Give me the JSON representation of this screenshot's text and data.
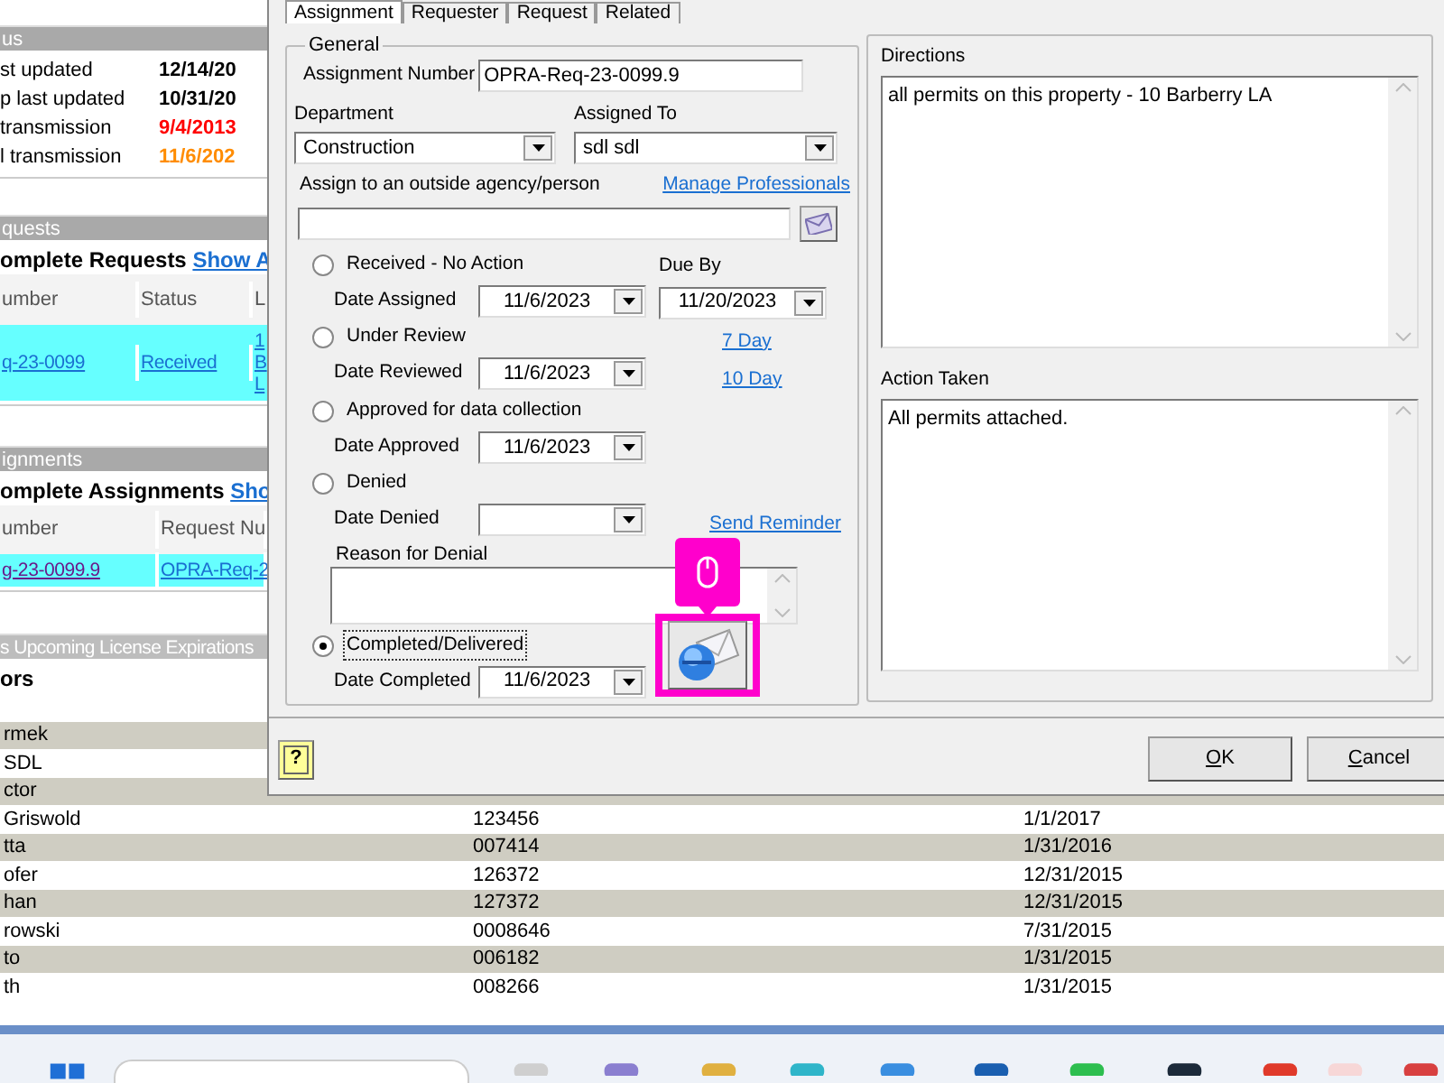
{
  "background_page": {
    "status_section": {
      "title": "us",
      "rows": [
        {
          "label": "st updated",
          "value": "12/14/20",
          "color": "#000000"
        },
        {
          "label": "p last updated",
          "value": "10/31/20",
          "color": "#000000"
        },
        {
          "label": "transmission",
          "value": "9/4/2013",
          "color": "#ff0000"
        },
        {
          "label": "l transmission",
          "value": "11/6/202",
          "color": "#ff8c00"
        }
      ]
    },
    "requests_section": {
      "title": "quests",
      "heading": "omplete Requests",
      "link": "Show A",
      "columns": [
        "umber",
        "Status",
        "L"
      ],
      "rows": [
        {
          "cells": [
            "q-23-0099",
            "Received"
          ],
          "location_lines": [
            "1",
            "B",
            "L"
          ]
        }
      ]
    },
    "assignments_section": {
      "title": "ignments",
      "heading": "omplete Assignments",
      "link": "Sho",
      "columns": [
        "umber",
        "Request Nu"
      ],
      "rows": [
        {
          "cells": [
            "g-23-0099.9",
            "OPRA-Req-2"
          ]
        }
      ]
    },
    "licenses_section": {
      "title": "s Upcoming License Expirations",
      "heading": "ors",
      "rows": [
        {
          "cells": [
            "rmek",
            "",
            ""
          ]
        },
        {
          "cells": [
            "SDL",
            "",
            ""
          ]
        },
        {
          "cells": [
            "ctor",
            "",
            ""
          ]
        },
        {
          "cells": [
            "Griswold",
            "123456",
            "1/1/2017"
          ]
        },
        {
          "cells": [
            "tta",
            "007414",
            "1/31/2016"
          ]
        },
        {
          "cells": [
            "ofer",
            "126372",
            "12/31/2015"
          ]
        },
        {
          "cells": [
            "han",
            "127372",
            "12/31/2015"
          ]
        },
        {
          "cells": [
            "rowski",
            "0008646",
            "7/31/2015"
          ]
        },
        {
          "cells": [
            "to",
            "006182",
            "1/31/2015"
          ]
        },
        {
          "cells": [
            "th",
            "008266",
            "1/31/2015"
          ]
        }
      ]
    }
  },
  "dialog": {
    "tabs": [
      {
        "label": "Assignment",
        "selected": true
      },
      {
        "label": "Requester",
        "selected": false
      },
      {
        "label": "Request",
        "selected": false
      },
      {
        "label": "Related",
        "selected": false
      }
    ],
    "general": {
      "title": "General",
      "assignment_number": {
        "label": "Assignment Number",
        "value": "OPRA-Req-23-0099.9"
      },
      "department": {
        "label": "Department",
        "value": "Construction"
      },
      "assigned_to": {
        "label": "Assigned To",
        "value": "sdl sdl"
      },
      "outside_agency": {
        "label": "Assign to an outside agency/person",
        "link": "Manage Professionals"
      },
      "statuses": [
        {
          "label": "Received - No Action",
          "selected": false,
          "focused": false,
          "date_label": "Date Assigned",
          "date": "11/6/2023",
          "aside": {
            "kind": "due_date",
            "label": "Due By",
            "value": "11/20/2023"
          }
        },
        {
          "label": "Under Review",
          "selected": false,
          "focused": false,
          "date_label": "Date Reviewed",
          "date": "11/6/2023",
          "aside": {
            "kind": "links",
            "links": [
              "7 Day",
              "10 Day"
            ]
          }
        },
        {
          "label": "Approved for data collection",
          "selected": false,
          "focused": false,
          "date_label": "Date Approved",
          "date": "11/6/2023"
        },
        {
          "label": "Denied",
          "selected": false,
          "focused": false,
          "date_label": "Date Denied",
          "aside": {
            "kind": "reminder",
            "link": "Send Reminder",
            "reason_label": "Reason for Denial"
          }
        },
        {
          "label": "Completed/Delivered",
          "selected": true,
          "focused": true,
          "date_label": "Date Completed",
          "date": "11/6/2023",
          "aside": {
            "kind": "email_button"
          }
        }
      ]
    },
    "directions": {
      "label": "Directions",
      "value": "all permits on this property - 10 Barberry LA"
    },
    "action_taken": {
      "label": "Action Taken",
      "value": "All permits attached."
    },
    "help_button": {
      "label": "?"
    },
    "buttons": [
      {
        "label": "OK"
      },
      {
        "label": "Cancel"
      }
    ]
  }
}
